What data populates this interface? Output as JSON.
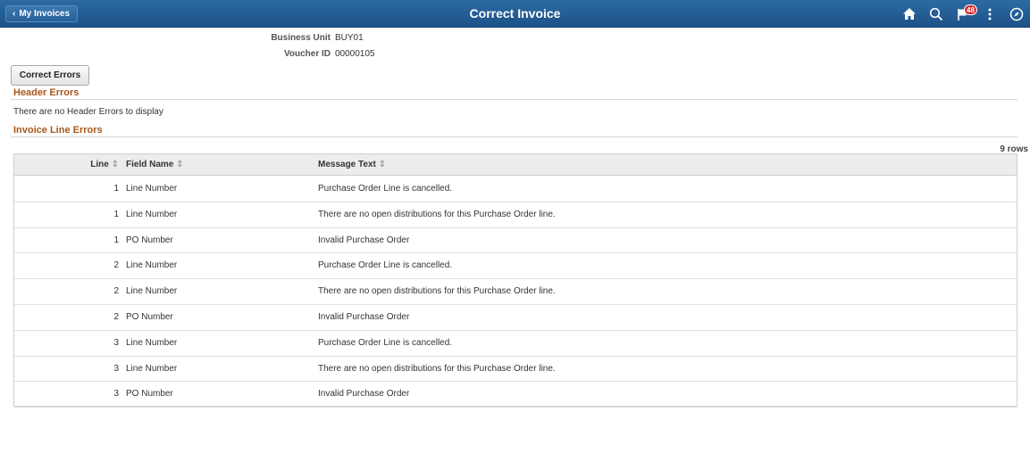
{
  "banner": {
    "back_label": "My Invoices",
    "title": "Correct Invoice",
    "notification_count": "48",
    "colors": {
      "banner": "#2c6aa3",
      "accent": "#a8561a",
      "badge": "#d7262c"
    }
  },
  "header": {
    "business_unit_label": "Business Unit",
    "business_unit_value": "BUY01",
    "voucher_id_label": "Voucher ID",
    "voucher_id_value": "00000105"
  },
  "correct_errors_label": "Correct Errors",
  "header_errors": {
    "title": "Header Errors",
    "empty_message": "There are no Header Errors to display"
  },
  "line_errors": {
    "title": "Invoice Line Errors",
    "row_count": "9 rows",
    "columns": {
      "line": "Line",
      "field_name": "Field Name",
      "message_text": "Message Text"
    },
    "rows": [
      {
        "line": "1",
        "field": "Line Number",
        "message": "Purchase Order Line is cancelled."
      },
      {
        "line": "1",
        "field": "Line Number",
        "message": "There are no open distributions for this Purchase Order line."
      },
      {
        "line": "1",
        "field": "PO Number",
        "message": "Invalid Purchase Order"
      },
      {
        "line": "2",
        "field": "Line Number",
        "message": "Purchase Order Line is cancelled."
      },
      {
        "line": "2",
        "field": "Line Number",
        "message": "There are no open distributions for this Purchase Order line."
      },
      {
        "line": "2",
        "field": "PO Number",
        "message": "Invalid Purchase Order"
      },
      {
        "line": "3",
        "field": "Line Number",
        "message": "Purchase Order Line is cancelled."
      },
      {
        "line": "3",
        "field": "Line Number",
        "message": "There are no open distributions for this Purchase Order line."
      },
      {
        "line": "3",
        "field": "PO Number",
        "message": "Invalid Purchase Order"
      }
    ]
  },
  "icons": [
    "chevron-left-icon",
    "home-icon",
    "search-icon",
    "flag-icon",
    "more-options-icon",
    "navbar-compass-icon",
    "sort-icon"
  ]
}
